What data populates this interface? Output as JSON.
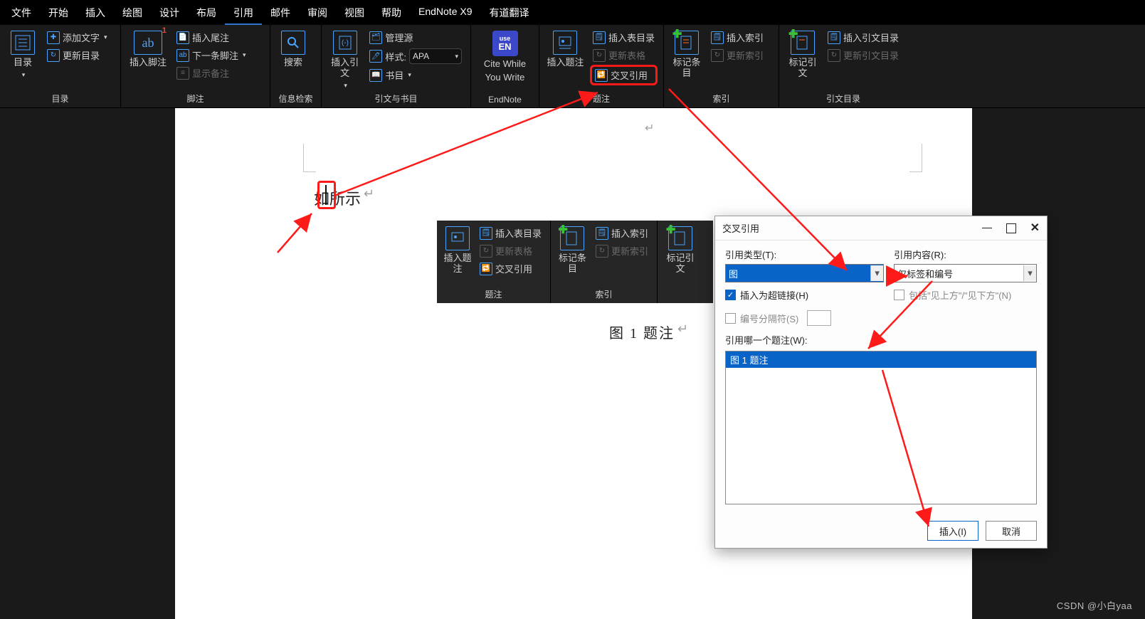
{
  "menubar": {
    "items": [
      "文件",
      "开始",
      "插入",
      "绘图",
      "设计",
      "布局",
      "引用",
      "邮件",
      "审阅",
      "视图",
      "帮助",
      "EndNote X9",
      "有道翻译"
    ],
    "active_index": 6
  },
  "ribbon": {
    "toc": {
      "big": "目录",
      "add_text": "添加文字",
      "update": "更新目录",
      "title": "目录"
    },
    "footnote": {
      "big": "插入脚注",
      "badge": "1",
      "insert_endnote": "插入尾注",
      "next_footnote": "下一条脚注",
      "show_notes": "显示备注",
      "title": "脚注"
    },
    "search": {
      "big": "搜索",
      "title": "信息检索"
    },
    "citation": {
      "big": "插入引文",
      "manage_sources": "管理源",
      "style_label": "样式:",
      "style_value": "APA",
      "bibliography": "书目",
      "title": "引文与书目"
    },
    "endnote": {
      "use": "use",
      "en": "EN",
      "line1": "Cite While",
      "line2": "You Write",
      "title": "EndNote"
    },
    "caption": {
      "big": "插入题注",
      "insert_tof": "插入表目录",
      "update_tof": "更新表格",
      "cross_ref": "交叉引用",
      "title": "题注"
    },
    "index": {
      "big": "标记条目",
      "insert_index": "插入索引",
      "update_index": "更新索引",
      "title": "索引"
    },
    "toa": {
      "big": "标记引文",
      "insert_toa": "插入引文目录",
      "update_toa": "更新引文目录",
      "title": "引文目录"
    }
  },
  "document": {
    "body_text": "如|所示",
    "display_text": "如所示",
    "caption_text": "图 1 题注",
    "para_mark": "↵"
  },
  "dialog": {
    "title": "交叉引用",
    "ref_type_label": "引用类型(T):",
    "ref_type_value": "图",
    "ref_content_label": "引用内容(R):",
    "ref_content_value": "仅标签和编号",
    "insert_hyperlink": "插入为超链接(H)",
    "include_above_below": "包括\"见上方\"/\"见下方\"(N)",
    "separator": "编号分隔符(S)",
    "which_caption_label": "引用哪一个题注(W):",
    "list_item": "图 1 题注",
    "insert_btn": "插入(I)",
    "cancel_btn": "取消"
  },
  "watermark": "CSDN @小白yaa"
}
